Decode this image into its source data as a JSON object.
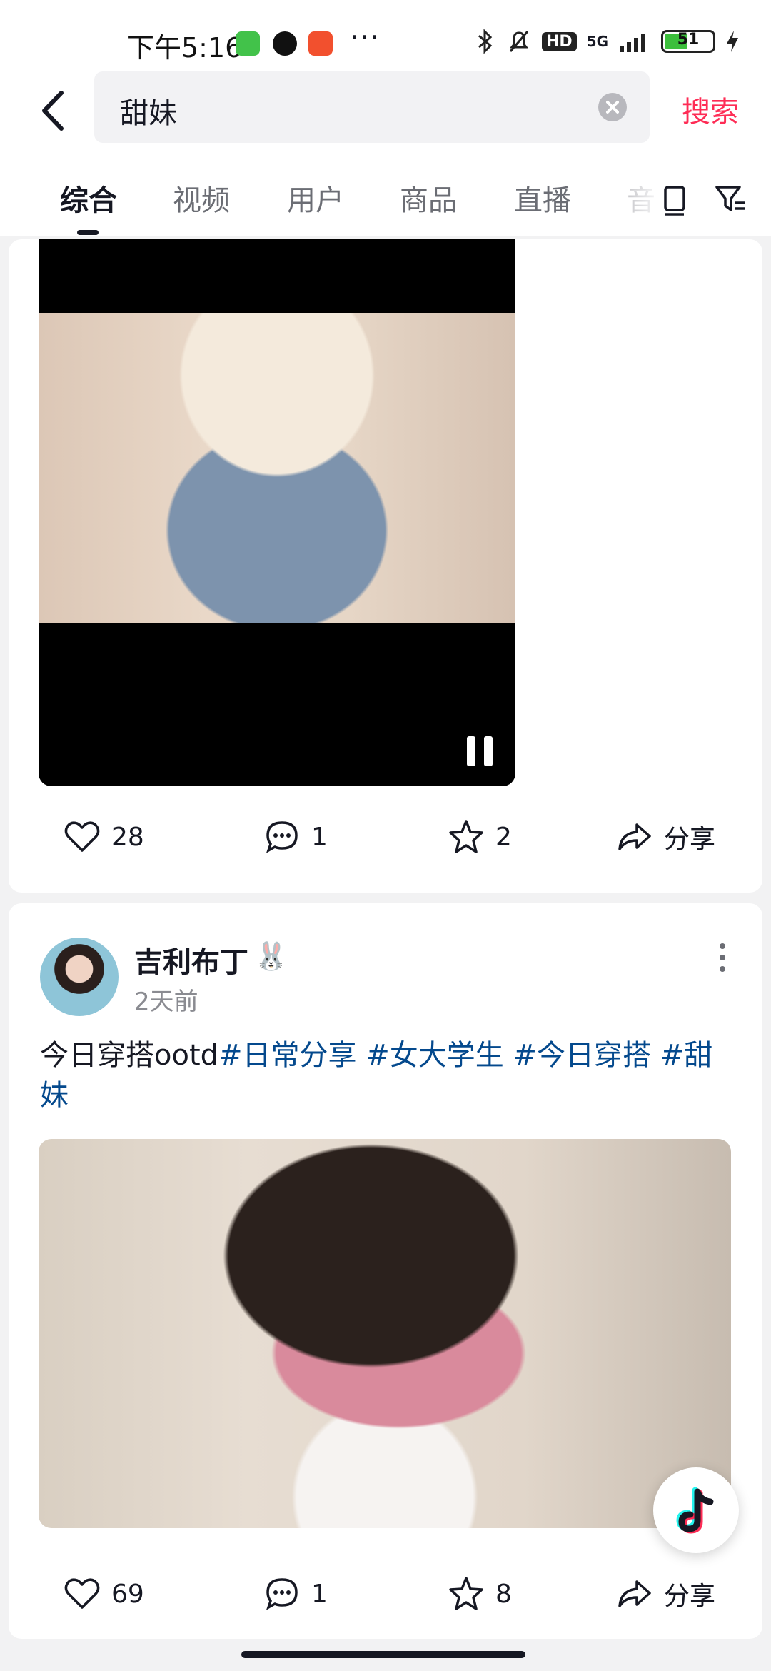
{
  "status_bar": {
    "time": "下午5:16",
    "network": "5G",
    "hd_badge": "HD",
    "battery": "51",
    "more": "···"
  },
  "search": {
    "query": "甜妹",
    "button_label": "搜索"
  },
  "tabs": [
    {
      "label": "综合",
      "active": true
    },
    {
      "label": "视频",
      "active": false
    },
    {
      "label": "用户",
      "active": false
    },
    {
      "label": "商品",
      "active": false
    },
    {
      "label": "直播",
      "active": false
    },
    {
      "label": "音",
      "active": false
    }
  ],
  "post1": {
    "likes": "28",
    "comments": "1",
    "favorites": "2",
    "share_label": "分享"
  },
  "post2": {
    "author": "吉利布丁",
    "author_emoji": "🐰",
    "time": "2天前",
    "text_plain": "今日穿搭ootd",
    "hashtags": [
      "#日常分享",
      "#女大学生",
      "#今日穿搭",
      "#甜妹"
    ],
    "likes": "69",
    "comments": "1",
    "favorites": "8",
    "share_label": "分享"
  },
  "colors": {
    "accent": "#fe2c55",
    "hashtag": "#04498d",
    "text": "#161823",
    "muted": "#8a8b91"
  }
}
